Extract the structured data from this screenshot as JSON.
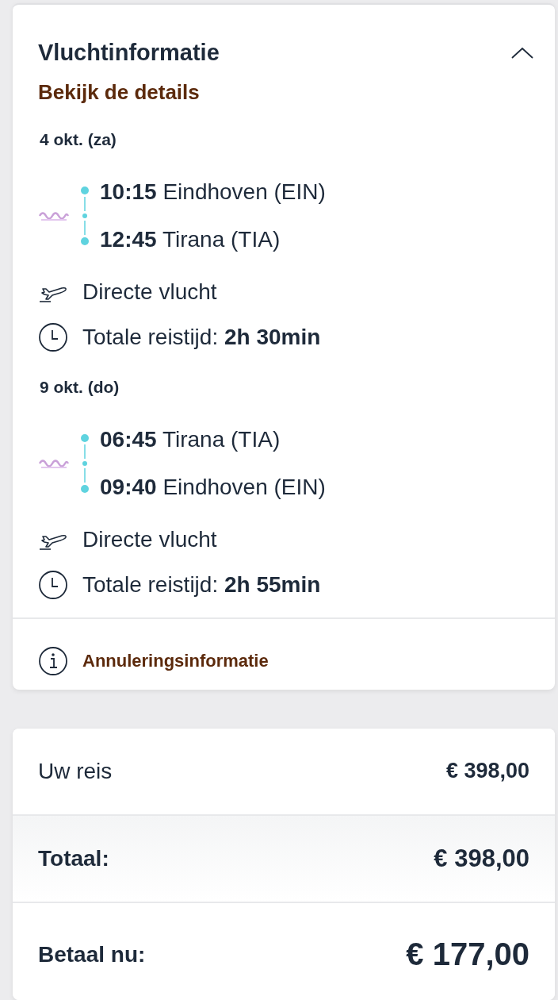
{
  "flight_info": {
    "title": "Vluchtinformatie",
    "expanded": true,
    "details_link": "Bekijk de details",
    "legs": [
      {
        "date": "4 okt. (za)",
        "segments": [
          {
            "time": "10:15",
            "place": "Eindhoven (EIN)"
          },
          {
            "time": "12:45",
            "place": "Tirana (TIA)"
          }
        ],
        "flight_type": "Directe vlucht",
        "duration": "Totale reistijd: **2h 30min**"
      },
      {
        "date": "9 okt. (do)",
        "segments": [
          {
            "time": "06:45",
            "place": "Tirana (TIA)"
          },
          {
            "time": "09:40",
            "place": "Eindhoven (EIN)"
          }
        ],
        "flight_type": "Directe vlucht",
        "duration": "Totale reistijd: **2h 55min**"
      }
    ],
    "cancellation_link": "Annuleringsinformatie"
  },
  "price_summary": [
    {
      "kind": "line",
      "label": "Uw reis",
      "amount": "€ 398,00"
    },
    {
      "kind": "total",
      "label": "Totaal:",
      "amount": "€ 398,00"
    },
    {
      "kind": "pay",
      "label": "Betaal nu:",
      "amount": "€ 177,00"
    }
  ]
}
